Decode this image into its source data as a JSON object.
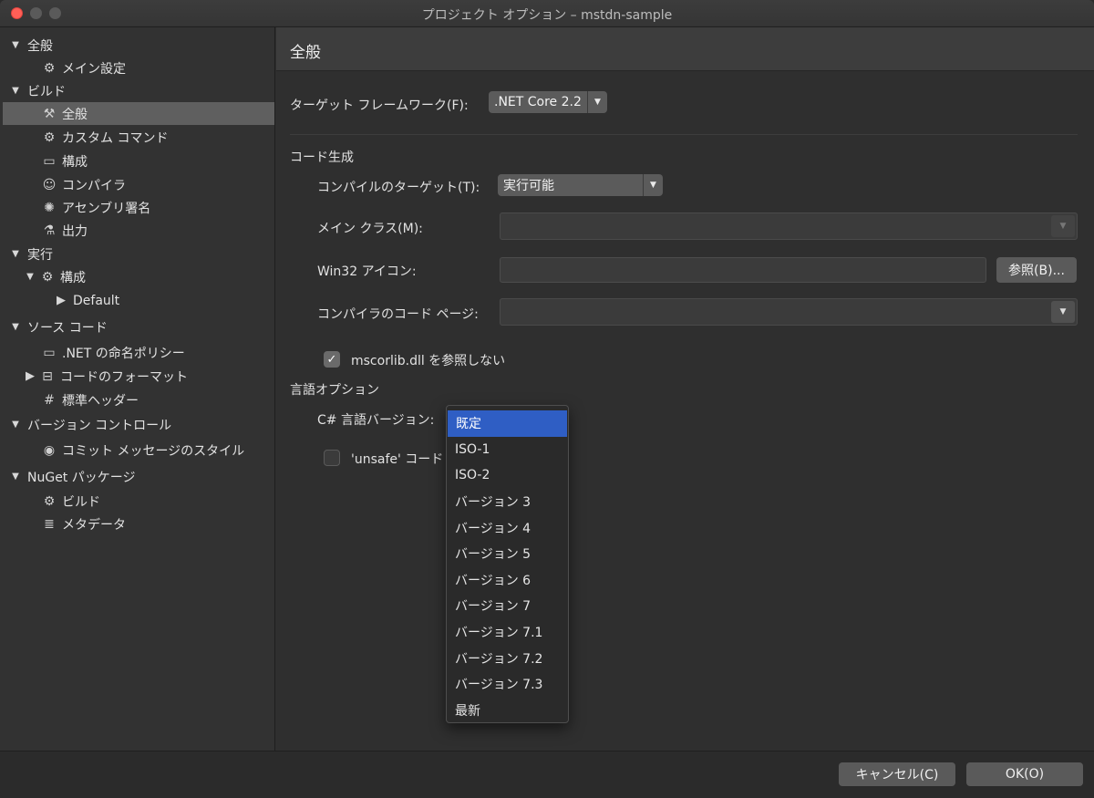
{
  "window": {
    "title": "プロジェクト オプション – mstdn-sample"
  },
  "sidebar": {
    "items": [
      {
        "label": "全般",
        "tri": "▼",
        "icon": ""
      },
      {
        "label": "メイン設定",
        "tri": "",
        "icon": "gear"
      },
      {
        "label": "ビルド",
        "tri": "▼",
        "icon": ""
      },
      {
        "label": "全般",
        "tri": "",
        "icon": "hammer",
        "selected": true
      },
      {
        "label": "カスタム コマンド",
        "tri": "",
        "icon": "gear"
      },
      {
        "label": "構成",
        "tri": "",
        "icon": "window"
      },
      {
        "label": "コンパイラ",
        "tri": "",
        "icon": "robot"
      },
      {
        "label": "アセンブリ署名",
        "tri": "",
        "icon": "seal"
      },
      {
        "label": "出力",
        "tri": "",
        "icon": "flask"
      },
      {
        "label": "実行",
        "tri": "▼",
        "icon": ""
      },
      {
        "label": "構成",
        "tri": "▼",
        "icon": "gear"
      },
      {
        "label": "Default",
        "tri": "▶",
        "icon": ""
      },
      {
        "label": "ソース コード",
        "tri": "▼",
        "icon": ""
      },
      {
        "label": ".NET の命名ポリシー",
        "tri": "",
        "icon": "abc"
      },
      {
        "label": "コードのフォーマット",
        "tri": "▶",
        "icon": "format"
      },
      {
        "label": "標準ヘッダー",
        "tri": "",
        "icon": "hash"
      },
      {
        "label": "バージョン コントロール",
        "tri": "▼",
        "icon": ""
      },
      {
        "label": "コミット メッセージのスタイル",
        "tri": "",
        "icon": "check-circle"
      },
      {
        "label": "NuGet パッケージ",
        "tri": "▼",
        "icon": ""
      },
      {
        "label": "ビルド",
        "tri": "",
        "icon": "gear"
      },
      {
        "label": "メタデータ",
        "tri": "",
        "icon": "doc"
      }
    ]
  },
  "content": {
    "header": "全般",
    "target_framework": {
      "label": "ターゲット フレームワーク(F):",
      "value": ".NET Core 2.2"
    },
    "codegen": {
      "section": "コード生成",
      "compile_target": {
        "label": "コンパイルのターゲット(T):",
        "value": "実行可能"
      },
      "main_class": {
        "label": "メイン クラス(M):"
      },
      "win32_icon": {
        "label": "Win32 アイコン:",
        "browse": "参照(B)..."
      },
      "code_page": {
        "label": "コンパイラのコード ページ:"
      },
      "no_mscorlib": {
        "label": "mscorlib.dll を参照しない",
        "checked": true
      }
    },
    "language": {
      "section": "言語オプション",
      "csharp_version": {
        "label": "C# 言語バージョン:"
      },
      "unsafe": {
        "label": "'unsafe' コード",
        "checked": false
      }
    }
  },
  "dropdown": {
    "selected": "既定",
    "options": [
      "既定",
      "ISO-1",
      "ISO-2",
      "バージョン 3",
      "バージョン 4",
      "バージョン 5",
      "バージョン 6",
      "バージョン 7",
      "バージョン 7.1",
      "バージョン 7.2",
      "バージョン 7.3",
      "最新"
    ]
  },
  "footer": {
    "cancel": "キャンセル(C)",
    "ok": "OK(O)"
  }
}
